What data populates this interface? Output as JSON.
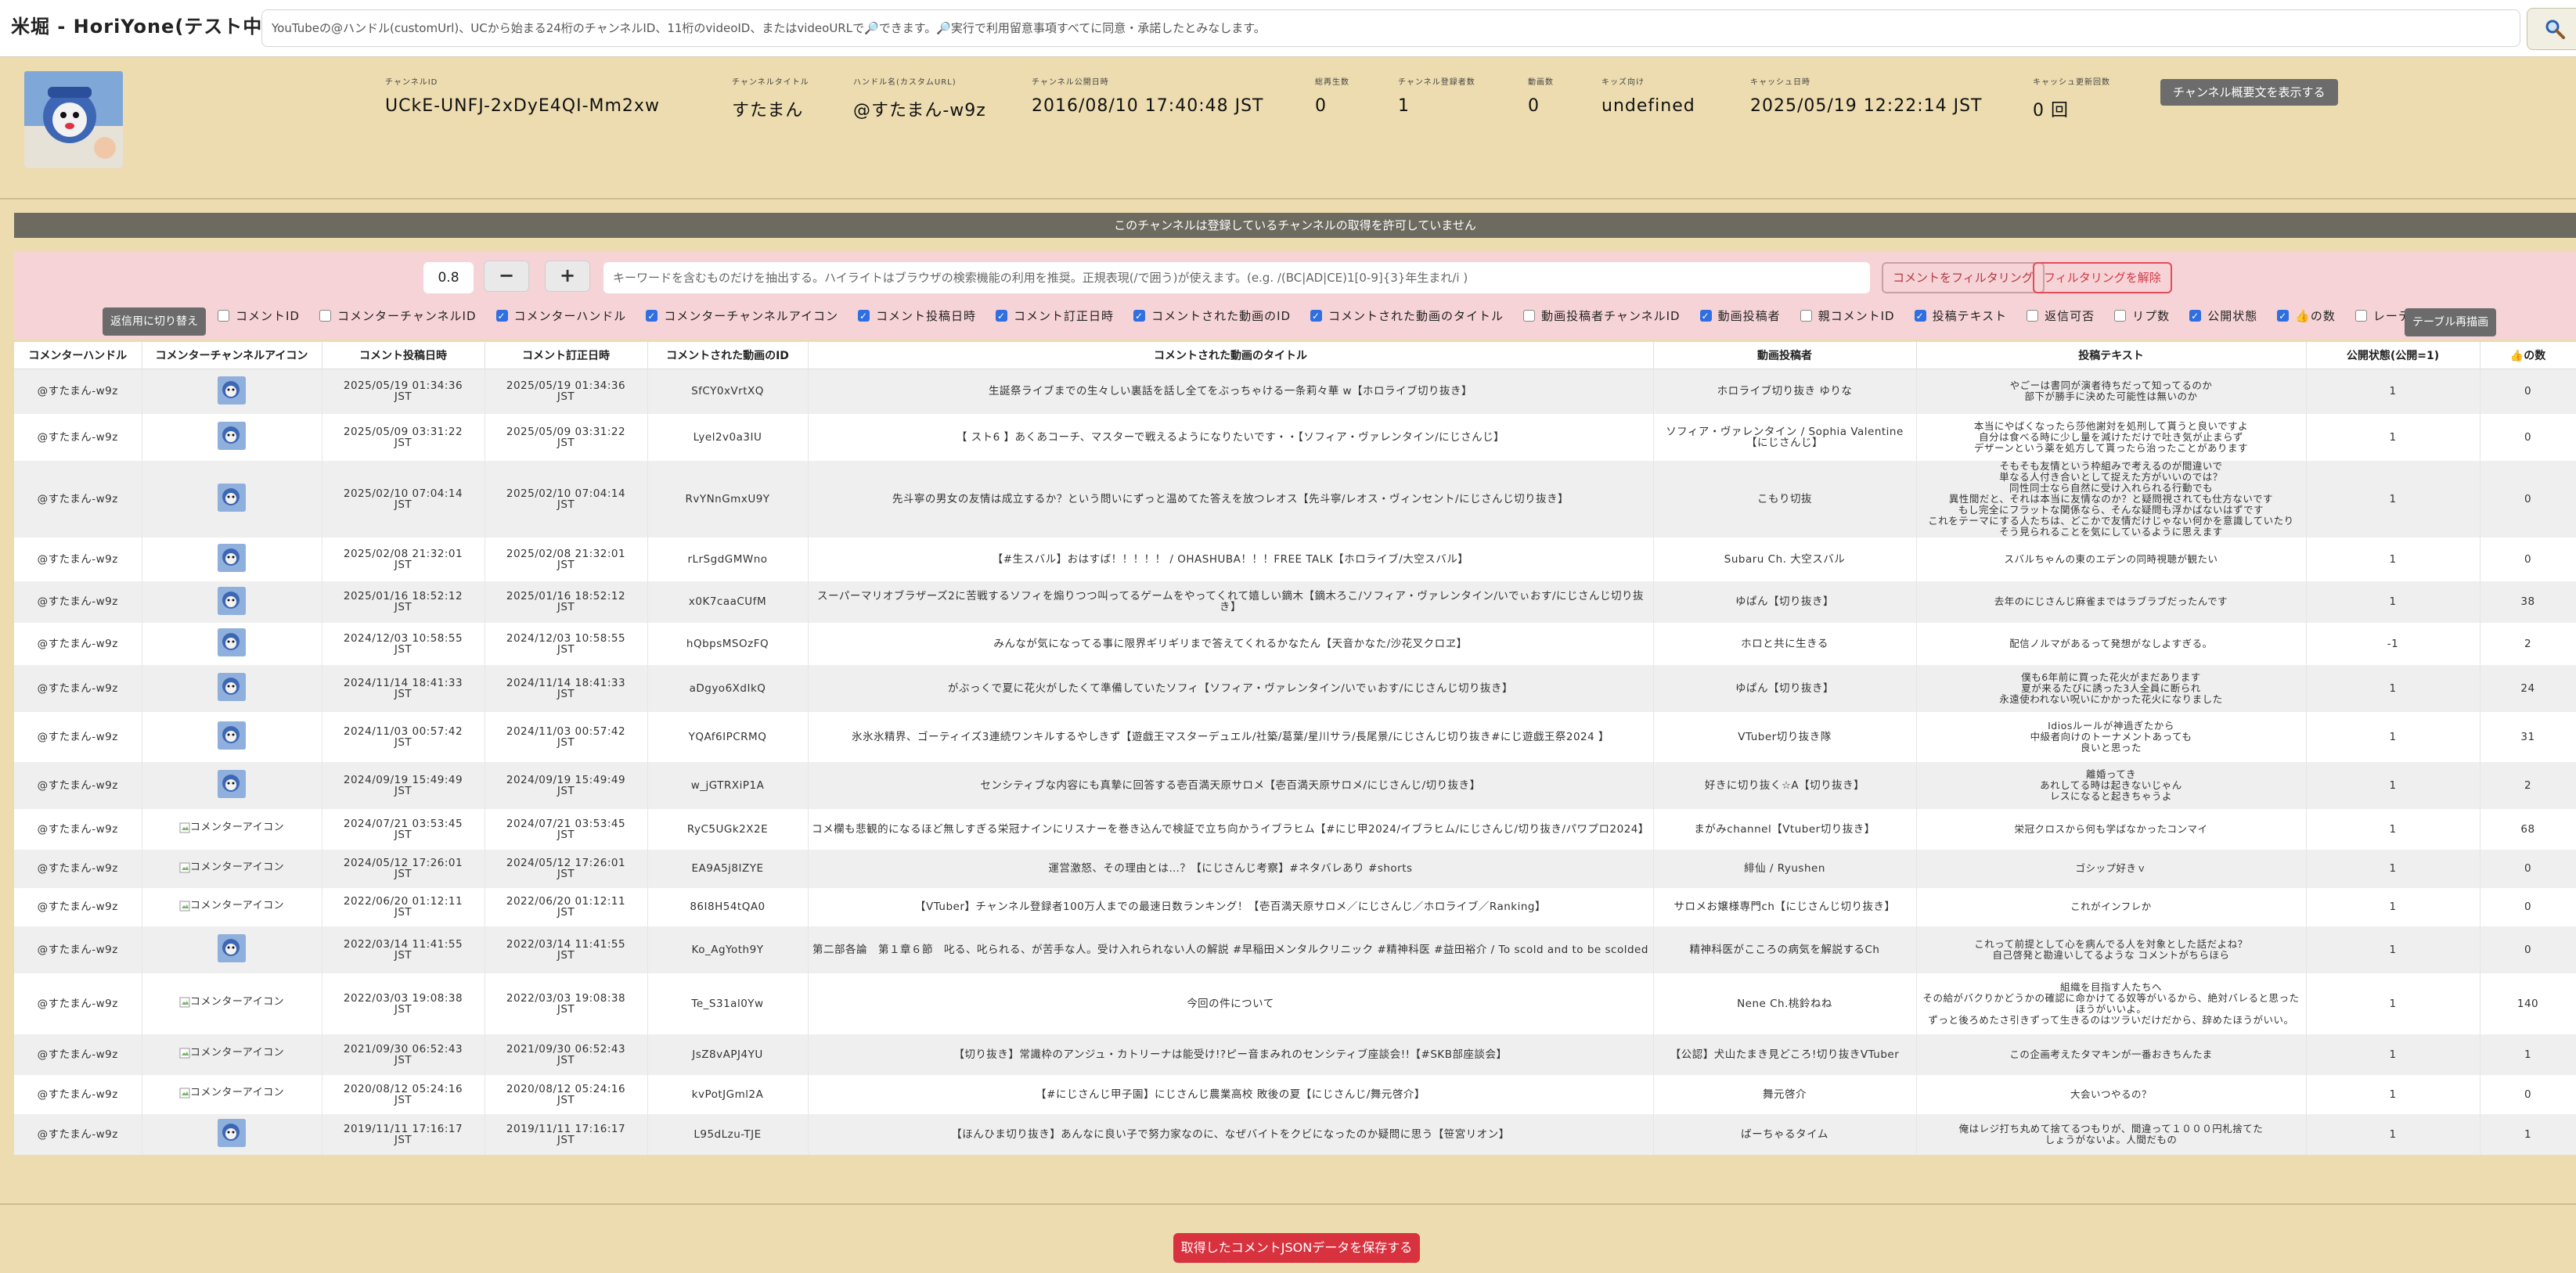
{
  "header": {
    "app_title": "米堀 - HoriYone(テスト中)",
    "search_placeholder": "YouTubeの@ハンドル(customUrl)、UCから始まる24桁のチャンネルID、11桁のvideoID、またはvideoURLで🔎できます。🔎実行で利用留意事項すべてに同意・承諾したとみなします。",
    "search_icon": "magnifier-icon"
  },
  "channel": {
    "avatar_icon": "channel-avatar",
    "fields": [
      {
        "label": "チャンネルID",
        "value": "UCkE-UNFJ-2xDyE4QI-Mm2xw"
      },
      {
        "label": "チャンネルタイトル",
        "value": "すたまん"
      },
      {
        "label": "ハンドル名(カスタムURL)",
        "value": "@すたまん-w9z"
      },
      {
        "label": "チャンネル公開日時",
        "value": "2016/08/10 17:40:48 JST"
      },
      {
        "label": "総再生数",
        "value": "0"
      },
      {
        "label": "チャンネル登録者数",
        "value": "1"
      },
      {
        "label": "動画数",
        "value": "0"
      },
      {
        "label": "キッズ向け",
        "value": "undefined"
      },
      {
        "label": "キャッシュ日時",
        "value": "2025/05/19 12:22:14 JST"
      },
      {
        "label": "キャッシュ更新回数",
        "value": "0 回"
      }
    ],
    "show_description_label": "チャンネル概要文を表示する"
  },
  "notice": "このチャンネルは登録しているチャンネルの取得を許可していません",
  "filter": {
    "threshold": "0.8",
    "minus_label": "−",
    "plus_label": "+",
    "keyword_placeholder": "キーワードを含むものだけを抽出する。ハイライトはブラウザの検索機能の利用を推奨。正規表現(/で囲う)が使えます。(e.g. /(BC|AD|CE)1[0-9]{3}年生まれ/i )",
    "filter_label": "コメントをフィルタリング",
    "clear_label": "フィルタリングを解除",
    "reply_toggle_label": "返信用に切り替え",
    "redraw_label": "テーブル再描画",
    "columns": [
      {
        "label": "コメントID",
        "checked": false
      },
      {
        "label": "コメンターチャンネルID",
        "checked": false
      },
      {
        "label": "コメンターハンドル",
        "checked": true
      },
      {
        "label": "コメンターチャンネルアイコン",
        "checked": true
      },
      {
        "label": "コメント投稿日時",
        "checked": true
      },
      {
        "label": "コメント訂正日時",
        "checked": true
      },
      {
        "label": "コメントされた動画のID",
        "checked": true
      },
      {
        "label": "コメントされた動画のタイトル",
        "checked": true
      },
      {
        "label": "動画投稿者チャンネルID",
        "checked": false
      },
      {
        "label": "動画投稿者",
        "checked": true
      },
      {
        "label": "親コメントID",
        "checked": false
      },
      {
        "label": "投稿テキスト",
        "checked": true
      },
      {
        "label": "返信可否",
        "checked": false
      },
      {
        "label": "リプ数",
        "checked": false
      },
      {
        "label": "公開状態",
        "checked": true
      },
      {
        "label": "👍の数",
        "checked": true
      },
      {
        "label": "レーティング",
        "checked": false
      }
    ]
  },
  "table": {
    "headers": [
      "コメンターハンドル",
      "コメンターチャンネルアイコン",
      "コメント投稿日時",
      "コメント訂正日時",
      "コメントされた動画のID",
      "コメントされた動画のタイトル",
      "動画投稿者",
      "投稿テキスト",
      "公開状態(公開=1)",
      "👍の数"
    ],
    "icon_alt": "コメンターアイコン",
    "rows": [
      {
        "handle": "@すたまん-w9z",
        "icon": "avatar",
        "posted": "2025/05/19 01:34:36\nJST",
        "edited": "2025/05/19 01:34:36\nJST",
        "video_id": "SfCY0xVrtXQ",
        "title": "生誕祭ライブまでの生々しい裏話を話し全てをぶっちゃける一条莉々華 w【ホロライブ切り抜き】",
        "uploader": "ホロライブ切り抜き ゆりな",
        "text": "やごーは書同が演者待ちだって知ってるのか\n部下が勝手に決めた可能性は無いのか",
        "public": "1",
        "likes": "0"
      },
      {
        "handle": "@すたまん-w9z",
        "icon": "avatar",
        "posted": "2025/05/09 03:31:22\nJST",
        "edited": "2025/05/09 03:31:22\nJST",
        "video_id": "Lyel2v0a3IU",
        "title": "【 スト6 】あくあコーチ、マスターで戦えるようになりたいです・・【ソフィア・ヴァレンタイン/にじさんじ】",
        "uploader": "ソフィア・ヴァレンタイン / Sophia Valentine【にじさんじ】",
        "text": "本当にやばくなったら莎他謝対を処刑して貰うと良いですよ\n自分は食べる時に少し量を減けただけで吐き気が止まらず\nデザーンという薬を処方して貰ったら治ったことがあります",
        "public": "1",
        "likes": "0"
      },
      {
        "handle": "@すたまん-w9z",
        "icon": "avatar",
        "posted": "2025/02/10 07:04:14\nJST",
        "edited": "2025/02/10 07:04:14\nJST",
        "video_id": "RvYNnGmxU9Y",
        "title": "先斗寧の男女の友情は成立するか？という問いにずっと温めてた答えを放つレオス【先斗寧/レオス・ヴィンセント/にじさんじ切り抜き】",
        "uploader": "こもり切抜",
        "text": "そもそも友情という枠組みで考えるのが間違いで\n単なる人付き合いとして捉えた方がいいのでは？\n同性同士なら自然に受け入れられる行動でも\n異性間だと、それは本当に友情なのか？と疑問視されても仕方ないです\nもし完全にフラットな関係なら、そんな疑問も浮かばないはずです\nこれをテーマにする人たちは、どこかで友情だけじゃない何かを意識していたり\nそう見られることを気にしているように思えます",
        "public": "1",
        "likes": "0"
      },
      {
        "handle": "@すたまん-w9z",
        "icon": "avatar",
        "posted": "2025/02/08 21:32:01\nJST",
        "edited": "2025/02/08 21:32:01\nJST",
        "video_id": "rLrSgdGMWno",
        "title": "【#生スバル】おはすば！！！！！ / OHASHUBA！！！FREE TALK【ホロライブ/大空スバル】",
        "uploader": "Subaru Ch. 大空スバル",
        "text": "スバルちゃんの東のエデンの同時視聴が観たい",
        "public": "1",
        "likes": "0"
      },
      {
        "handle": "@すたまん-w9z",
        "icon": "avatar",
        "posted": "2025/01/16 18:52:12\nJST",
        "edited": "2025/01/16 18:52:12\nJST",
        "video_id": "x0K7caaCUfM",
        "title": "スーパーマリオブラザーズ2に苦戦するソフィを煽りつつ叫ってるゲームをやってくれて嬉しい鏑木【鏑木ろこ/ソフィア・ヴァレンタイン/いでぃおす/にじさんじ切り抜き】",
        "uploader": "ゆぱん【切り抜き】",
        "text": "去年のにじさんじ麻雀まではラブラブだったんです",
        "public": "1",
        "likes": "38"
      },
      {
        "handle": "@すたまん-w9z",
        "icon": "avatar",
        "posted": "2024/12/03 10:58:55\nJST",
        "edited": "2024/12/03 10:58:55\nJST",
        "video_id": "hQbpsMSOzFQ",
        "title": "みんなが気になってる事に限界ギリギリまで答えてくれるかなたん【天音かなた/沙花叉クロヱ】",
        "uploader": "ホロと共に生きる",
        "text": "配信ノルマがあるって発想がなしよすぎる。",
        "public": "-1",
        "likes": "2"
      },
      {
        "handle": "@すたまん-w9z",
        "icon": "avatar",
        "posted": "2024/11/14 18:41:33\nJST",
        "edited": "2024/11/14 18:41:33\nJST",
        "video_id": "aDgyo6XdIkQ",
        "title": "がぶっくで夏に花火がしたくて準備していたソフィ【ソフィア・ヴァレンタイン/いでぃおす/にじさんじ切り抜き】",
        "uploader": "ゆぱん【切り抜き】",
        "text": "僕も6年前に買った花火がまだあります\n夏が来るたびに誘った3人全員に断られ\n永遠使われない呪いにかかった花火になりました",
        "public": "1",
        "likes": "24"
      },
      {
        "handle": "@すたまん-w9z",
        "icon": "avatar",
        "posted": "2024/11/03 00:57:42\nJST",
        "edited": "2024/11/03 00:57:42\nJST",
        "video_id": "YQAf6IPCRMQ",
        "title": "氷氷氷精界、ゴーティイズ3連続ワンキルするやしきず【遊戯王マスターデュエル/社築/葛葉/星川サラ/長尾景/にじさんじ切り抜き#にじ遊戯王祭2024 】",
        "uploader": "VTuber切り抜き隊",
        "text": "Idiosルールが神過ぎたから\n中級者向けのトーナメントあっても\n良いと思った",
        "public": "1",
        "likes": "31"
      },
      {
        "handle": "@すたまん-w9z",
        "icon": "avatar",
        "posted": "2024/09/19 15:49:49\nJST",
        "edited": "2024/09/19 15:49:49\nJST",
        "video_id": "w_jGTRXiP1A",
        "title": "センシティブな内容にも真摯に回答する壱百満天原サロメ【壱百満天原サロメ/にじさんじ/切り抜き】",
        "uploader": "好きに切り抜く☆A【切り抜き】",
        "text": "離婚ってき\nあれしてる時は起きないじゃん\nレスになると起きちゃうよ",
        "public": "1",
        "likes": "2"
      },
      {
        "handle": "@すたまん-w9z",
        "icon": "broken",
        "posted": "2024/07/21 03:53:45\nJST",
        "edited": "2024/07/21 03:53:45\nJST",
        "video_id": "RyC5UGk2X2E",
        "title": "コメ欄も悲観的になるほど無しすぎる栄冠ナインにリスナーを巻き込んで検証で立ち向かうイブラヒム【#にじ甲2024/イブラヒム/にじさんじ/切り抜き/パワプロ2024】",
        "uploader": "まがみchannel【Vtuber切り抜き】",
        "text": "栄冠クロスから何も学ばなかったコンマイ",
        "public": "1",
        "likes": "68"
      },
      {
        "handle": "@すたまん-w9z",
        "icon": "broken",
        "posted": "2024/05/12 17:26:01\nJST",
        "edited": "2024/05/12 17:26:01\nJST",
        "video_id": "EA9A5j8IZYE",
        "title": "運営激怒、その理由とは…？【にじさんじ考察】#ネタバレあり #shorts",
        "uploader": "緋仙 / Ryushen",
        "text": "ゴシップ好きｖ",
        "public": "1",
        "likes": "0"
      },
      {
        "handle": "@すたまん-w9z",
        "icon": "broken",
        "posted": "2022/06/20 01:12:11\nJST",
        "edited": "2022/06/20 01:12:11\nJST",
        "video_id": "86I8H54tQA0",
        "title": "【VTuber】チャンネル登録者100万人までの最速日数ランキング！【壱百満天原サロメ／にじさんじ／ホロライブ／Ranking】",
        "uploader": "サロメお嬢様専門ch【にじさんじ切り抜き】",
        "text": "これがインフレか",
        "public": "1",
        "likes": "0"
      },
      {
        "handle": "@すたまん-w9z",
        "icon": "avatar",
        "posted": "2022/03/14 11:41:55\nJST",
        "edited": "2022/03/14 11:41:55\nJST",
        "video_id": "Ko_AgYoth9Y",
        "title": "第二部各論　第１章６節　叱る、叱られる、が苦手な人。受け入れられない人の解説 #早稲田メンタルクリニック #精神科医 #益田裕介 / To scold and to be scolded",
        "uploader": "精神科医がこころの病気を解説するCh",
        "text": "これって前提として心を病んでる人を対象とした話だよね？\n自己啓発と勘違いしてるような コメントがちらほら",
        "public": "1",
        "likes": "0"
      },
      {
        "handle": "@すたまん-w9z",
        "icon": "broken",
        "posted": "2022/03/03 19:08:38\nJST",
        "edited": "2022/03/03 19:08:38\nJST",
        "video_id": "Te_S31al0Yw",
        "title": "今回の件について",
        "uploader": "Nene Ch.桃鈴ねね",
        "text": "組織を目指す人たちへ\nその給がバクりかどうかの確認に命かけてる奴等がいるから、絶対バレると思ったほうがいいよ。\nずっと後ろめたさ引きずって生きるのはツラいだけだから、辞めたほうがいい。",
        "public": "1",
        "likes": "140"
      },
      {
        "handle": "@すたまん-w9z",
        "icon": "broken",
        "posted": "2021/09/30 06:52:43\nJST",
        "edited": "2021/09/30 06:52:43\nJST",
        "video_id": "JsZ8vAPJ4YU",
        "title": "【切り抜き】常識枠のアンジュ・カトリーナは能受け!?ピー音まみれのセンシティブ座談会!!【#SKB部座談会】",
        "uploader": "【公認】犬山たまき見どころ!切り抜きVTuber",
        "text": "この企画考えたタマキンが一番おきちんたま",
        "public": "1",
        "likes": "1"
      },
      {
        "handle": "@すたまん-w9z",
        "icon": "broken",
        "posted": "2020/08/12 05:24:16\nJST",
        "edited": "2020/08/12 05:24:16\nJST",
        "video_id": "kvPotJGml2A",
        "title": "【#にじさんじ甲子園】にじさんじ農業高校 敗後の夏【にじさんじ/舞元啓介】",
        "uploader": "舞元啓介",
        "text": "大会いつやるの？",
        "public": "1",
        "likes": "0"
      },
      {
        "handle": "@すたまん-w9z",
        "icon": "avatar",
        "posted": "2019/11/11 17:16:17\nJST",
        "edited": "2019/11/11 17:16:17\nJST",
        "video_id": "L95dLzu-TJE",
        "title": "【ほんひま切り抜き】あんなに良い子で努力家なのに、なぜバイトをクビになったのか疑問に思う【笹宮リオン】",
        "uploader": "ばーちゃるタイム",
        "text": "俺はレジ打ち丸めて捨てるつもりが、間違って１０００円札捨てた\nしょうがないよ。人間だもの",
        "public": "1",
        "likes": "1"
      }
    ]
  },
  "footer": {
    "save_label": "取得したコメントJSONデータを保存する"
  },
  "colors": {
    "page_bg": "#ecdcaf",
    "notice_bg": "#6d6b5f",
    "filter_bg": "#f6d3d6",
    "accent_red": "#d9323f",
    "checkbox_blue": "#2f6fe0"
  }
}
